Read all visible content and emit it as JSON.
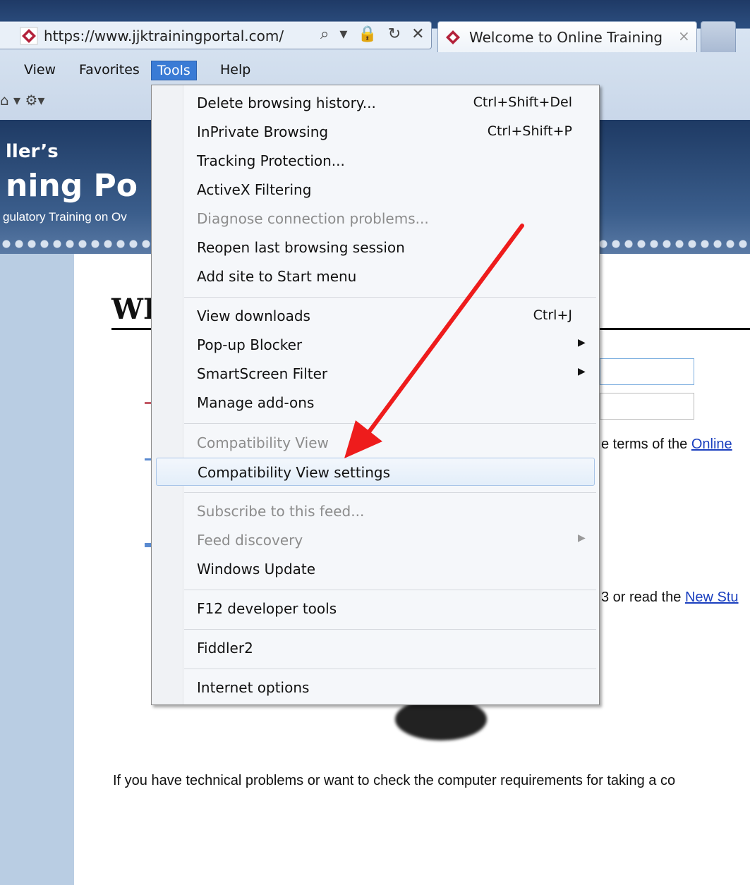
{
  "browser": {
    "url": "https://www.jjktrainingportal.com/",
    "address_tools": "⌕ ▾ 🔒 ↻ ✕",
    "tab_title": "Welcome to Online Training",
    "tab_close": "×"
  },
  "menubar": {
    "items": [
      "View",
      "Favorites",
      "Tools",
      "Help"
    ],
    "active": "Tools"
  },
  "cmdbar": {
    "icons": "⌂ ▾ ⚙▾"
  },
  "banner": {
    "line1": "ller’s",
    "line2": "ning Po",
    "line3": "gulatory Training on Ov"
  },
  "page": {
    "heading": "WE",
    "terms_prefix": "e terms of the ",
    "terms_link": "Online",
    "read_prefix": "3 or read the ",
    "read_link": "New Stu",
    "footer_text": "If you have technical problems or want to check the computer requirements for taking a co"
  },
  "tools_menu": {
    "items": [
      {
        "label": "Delete browsing history...",
        "shortcut": "Ctrl+Shift+Del",
        "disabled": false
      },
      {
        "label": "InPrivate Browsing",
        "shortcut": "Ctrl+Shift+P",
        "disabled": false
      },
      {
        "label": "Tracking Protection...",
        "shortcut": "",
        "disabled": false
      },
      {
        "label": "ActiveX Filtering",
        "shortcut": "",
        "disabled": false
      },
      {
        "label": "Diagnose connection problems...",
        "shortcut": "",
        "disabled": true
      },
      {
        "label": "Reopen last browsing session",
        "shortcut": "",
        "disabled": false
      },
      {
        "label": "Add site to Start menu",
        "shortcut": "",
        "disabled": false
      },
      {
        "label": "View downloads",
        "shortcut": "Ctrl+J",
        "disabled": false
      },
      {
        "label": "Pop-up Blocker",
        "shortcut": "",
        "disabled": false
      },
      {
        "label": "SmartScreen Filter",
        "shortcut": "",
        "disabled": false
      },
      {
        "label": "Manage add-ons",
        "shortcut": "",
        "disabled": false
      },
      {
        "label": "Compatibility View",
        "shortcut": "",
        "disabled": true
      },
      {
        "label": "Compatibility View settings",
        "shortcut": "",
        "disabled": false
      },
      {
        "label": "Subscribe to this feed...",
        "shortcut": "",
        "disabled": true
      },
      {
        "label": "Feed discovery",
        "shortcut": "",
        "disabled": true
      },
      {
        "label": "Windows Update",
        "shortcut": "",
        "disabled": false
      },
      {
        "label": "F12 developer tools",
        "shortcut": "",
        "disabled": false
      },
      {
        "label": "Fiddler2",
        "shortcut": "",
        "disabled": false
      },
      {
        "label": "Internet options",
        "shortcut": "",
        "disabled": false
      }
    ],
    "highlighted": "Compatibility View settings",
    "submenu_arrow": "▶"
  },
  "colors": {
    "annotation_arrow": "#ee1c1c",
    "menu_highlight_border": "#a9c5e8",
    "active_menu": "#3a7bd5"
  }
}
